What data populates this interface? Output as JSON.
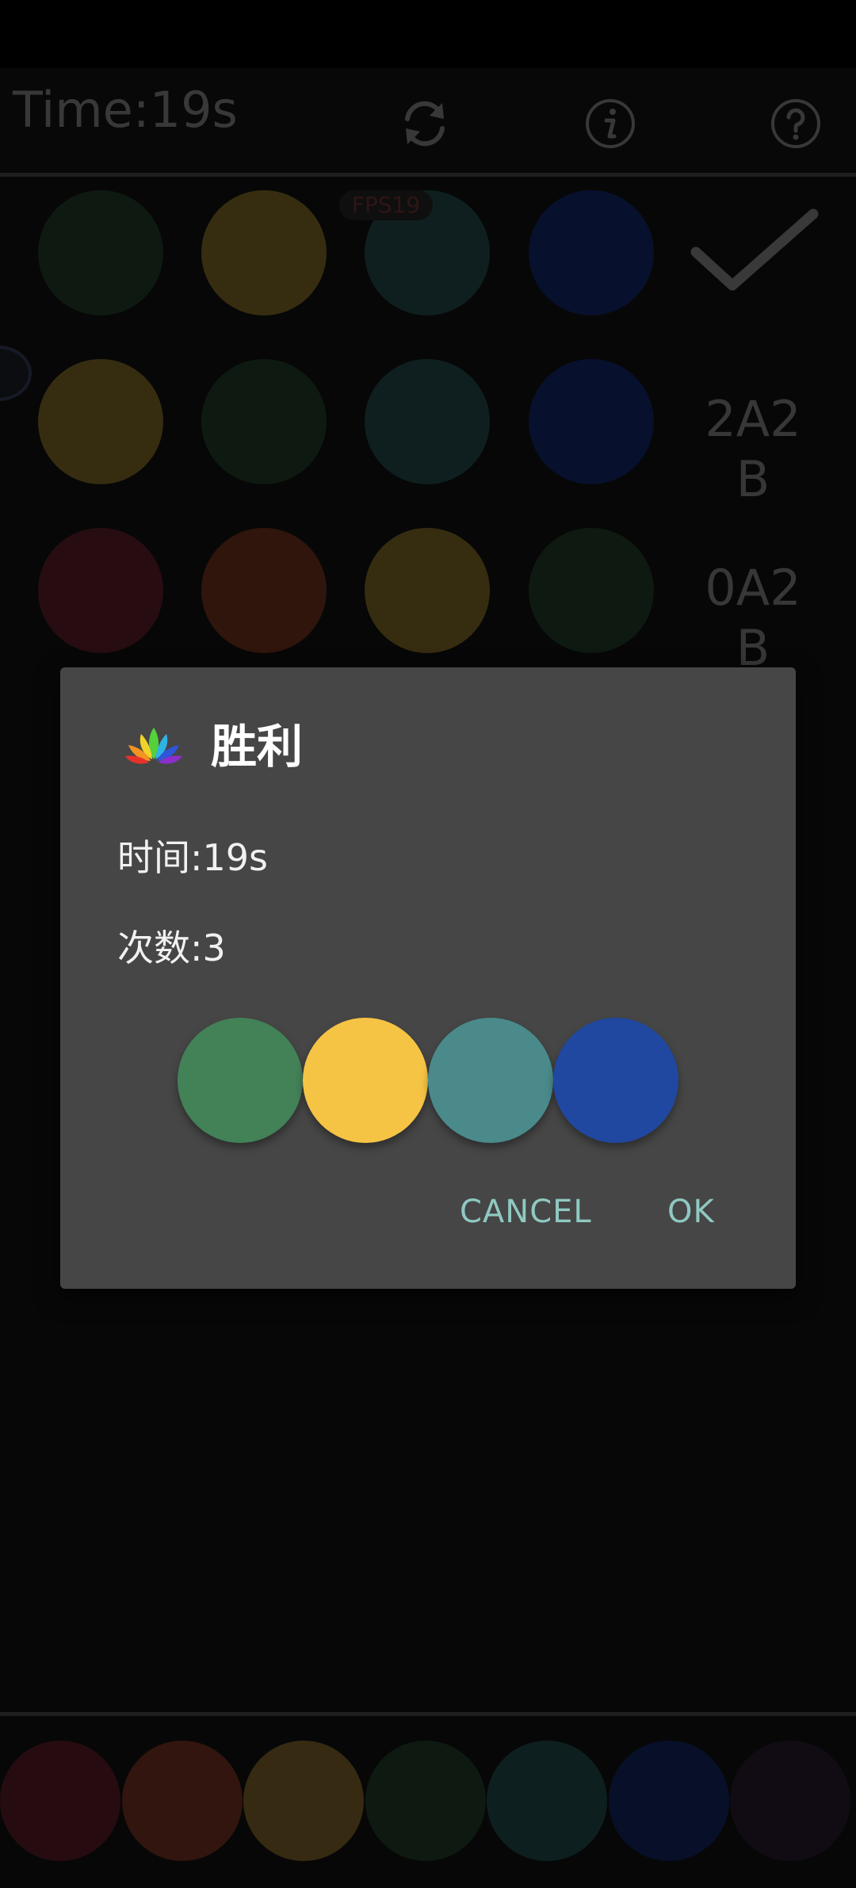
{
  "toolbar": {
    "time_text": "Time:19s",
    "icons": [
      "refresh-icon",
      "info-icon",
      "help-icon"
    ]
  },
  "overlay": {
    "fps_text": "FPS19"
  },
  "board": {
    "rows": [
      {
        "colors": [
          "#1b3322",
          "#685622",
          "#1d3c3c",
          "#0e2257"
        ],
        "result_icon": "check-icon"
      },
      {
        "colors": [
          "#685622",
          "#1b3322",
          "#1d3c3c",
          "#0e2257"
        ],
        "result_line1": "2A2",
        "result_line2": "B"
      },
      {
        "colors": [
          "#4b1a21",
          "#5c2a1a",
          "#685622",
          "#1b3322"
        ],
        "result_line1": "0A2",
        "result_line2": "B"
      }
    ]
  },
  "dialog": {
    "title": "胜利",
    "time_line": "时间:19s",
    "count_line": "次数:3",
    "answer_colors": [
      "#438157",
      "#f6c445",
      "#4a8a8b",
      "#2048a1"
    ],
    "cancel_label": "CANCEL",
    "ok_label": "OK",
    "logo_icon": "lotus-logo-icon"
  },
  "palette": {
    "colors": [
      "#4a1720",
      "#5e2a1b",
      "#685424",
      "#1b3321",
      "#1b3d3d",
      "#0e1f4e",
      "#221827"
    ]
  },
  "colors": {
    "background": "#0e0e0e",
    "dialog_bg": "#464646",
    "button_text": "#8fc9c1"
  }
}
